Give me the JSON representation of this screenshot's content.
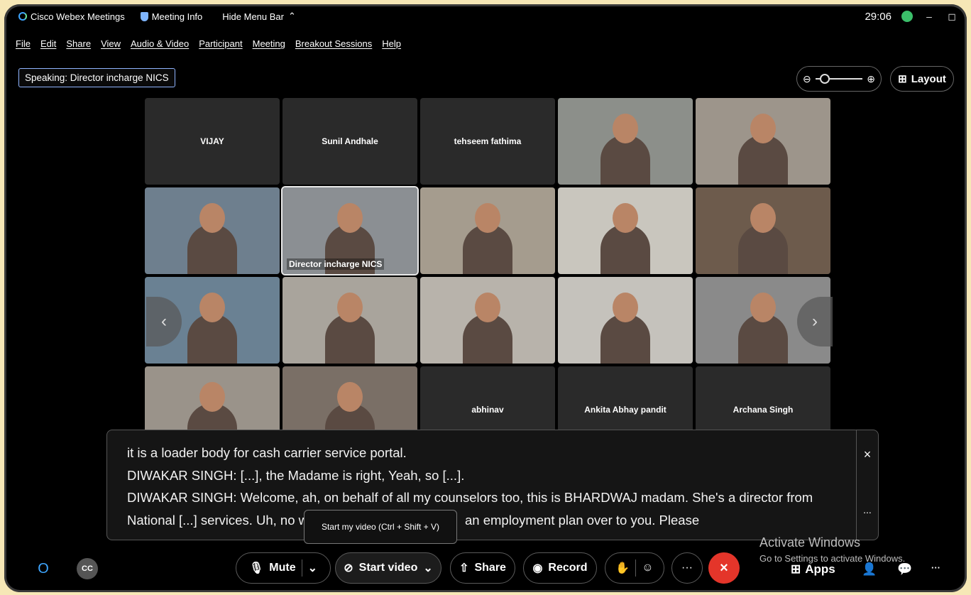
{
  "titlebar": {
    "app_name": "Cisco Webex Meetings",
    "meeting_info": "Meeting Info",
    "hide_menu_bar": "Hide Menu Bar",
    "timer": "29:06",
    "minimize": "–",
    "restore": "◻"
  },
  "menu": [
    "File",
    "Edit",
    "Share",
    "View",
    "Audio & Video",
    "Participant",
    "Meeting",
    "Breakout Sessions",
    "Help"
  ],
  "speaking": "Speaking: Director incharge NICS",
  "layout_label": "Layout",
  "zoom": {
    "minus": "⊖",
    "plus": "⊕",
    "level": 0.1
  },
  "participants": [
    {
      "name": "VIJAY",
      "video": false,
      "show_name": true
    },
    {
      "name": "Sunil Andhale",
      "video": false,
      "show_name": true
    },
    {
      "name": "tehseem fathima",
      "video": false,
      "show_name": true
    },
    {
      "name": "",
      "video": true,
      "show_name": false
    },
    {
      "name": "",
      "video": true,
      "show_name": false
    },
    {
      "name": "",
      "video": true,
      "show_name": false
    },
    {
      "name": "Director incharge NICS",
      "video": true,
      "show_name": true,
      "active": true
    },
    {
      "name": "",
      "video": true,
      "show_name": false
    },
    {
      "name": "",
      "video": true,
      "show_name": false
    },
    {
      "name": "",
      "video": true,
      "show_name": false
    },
    {
      "name": "",
      "video": true,
      "show_name": false
    },
    {
      "name": "",
      "video": true,
      "show_name": false
    },
    {
      "name": "",
      "video": true,
      "show_name": false
    },
    {
      "name": "",
      "video": true,
      "show_name": false
    },
    {
      "name": "",
      "video": true,
      "show_name": false
    },
    {
      "name": "",
      "video": true,
      "show_name": false
    },
    {
      "name": "",
      "video": true,
      "show_name": false
    },
    {
      "name": "abhinav",
      "video": false,
      "show_name": true
    },
    {
      "name": "Ankita Abhay pandit",
      "video": false,
      "show_name": true
    },
    {
      "name": "Archana Singh",
      "video": false,
      "show_name": true
    }
  ],
  "captions": {
    "lines": [
      "it is a loader body for cash carrier service portal.",
      "DIWAKAR SINGH: [...], the Madame is right, Yeah, so [...].",
      "DIWAKAR SINGH: Welcome, ah, on behalf of all my counselors too, this is BHARDWAJ madam. She's a director from",
      "National [...] services. Uh, no w                                           an employment plan over to you. Please"
    ],
    "close": "×",
    "more": "..."
  },
  "tooltip": "Start my video (Ctrl + Shift + V)",
  "toolbar": {
    "mute": "Mute",
    "start_video": "Start video",
    "share": "Share",
    "record": "Record",
    "more": "···",
    "end": "×",
    "apps": "Apps",
    "overflow": "···"
  },
  "watermark": {
    "line1": "Activate Windows",
    "line2": "Go to Settings to activate Windows."
  },
  "colors": {
    "end_call": "#e4352a",
    "active_outline": "#e8e8e8",
    "background_border": "#f6e7b6"
  }
}
